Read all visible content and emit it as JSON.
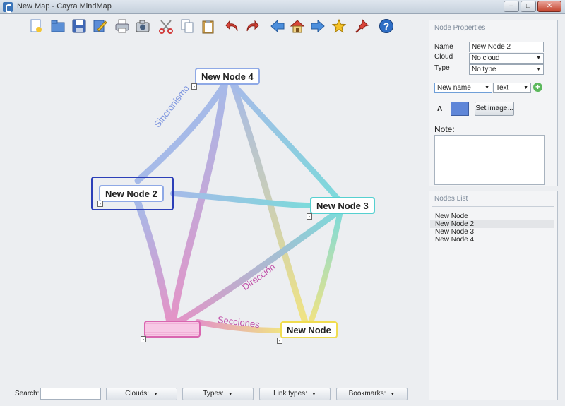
{
  "window": {
    "title": "New Map - Cayra MindMap",
    "min": "–",
    "max": "□",
    "close": "✕"
  },
  "toolbar": {
    "buttons": [
      {
        "name": "new-map-icon"
      },
      {
        "name": "open-icon"
      },
      {
        "name": "save-icon"
      },
      {
        "name": "edit-icon"
      },
      {
        "name": "print-icon"
      },
      {
        "name": "camera-icon"
      },
      {
        "name": "cut-icon"
      },
      {
        "name": "copy-icon"
      },
      {
        "name": "paste-icon"
      },
      {
        "name": "undo-icon"
      },
      {
        "name": "redo-icon"
      },
      {
        "name": "back-icon"
      },
      {
        "name": "home-icon"
      },
      {
        "name": "forward-icon"
      },
      {
        "name": "star-icon"
      },
      {
        "name": "pin-icon"
      },
      {
        "name": "help-icon"
      }
    ]
  },
  "map": {
    "nodes": {
      "node4": {
        "label": "New Node 4",
        "border": "#8fa9e6",
        "bg": "#ffffff"
      },
      "node2": {
        "label": "New Node 2",
        "border": "#8fa9e6",
        "bg": "#ffffff"
      },
      "node3": {
        "label": "New Node 3",
        "border": "#55d0d0",
        "bg": "#ffffff"
      },
      "node1": {
        "label": "New Node",
        "border": "#f0dc50",
        "bg": "#ffffff"
      },
      "root": {
        "label": "",
        "border": "#d966b0",
        "bg": "#f5c2e2"
      }
    },
    "collapse_symbol": "-",
    "link_labels": {
      "sincronismo": {
        "text": "Sincronismo",
        "color": "#7e96df"
      },
      "direccion": {
        "text": "Dirección",
        "color": "#c04da8"
      },
      "secciones": {
        "text": "Secciones",
        "color": "#c04da8"
      }
    }
  },
  "bottombar": {
    "search_label": "Search:",
    "search_value": "",
    "clouds": "Clouds:",
    "types": "Types:",
    "link_types": "Link types:",
    "bookmarks": "Bookmarks:"
  },
  "properties": {
    "title": "Node Properties",
    "name_label": "Name",
    "name_value": "New Node 2",
    "cloud_label": "Cloud",
    "cloud_value": "No cloud",
    "type_label": "Type",
    "type_value": "No type",
    "attr_name": "New name",
    "attr_type": "Text",
    "font_label": "A",
    "node_color": "#5f86d8",
    "set_image": "Set image...",
    "note_label": "Note:",
    "note_value": ""
  },
  "nodes_list": {
    "title": "Nodes List",
    "items": [
      "New Node",
      "New Node 2",
      "New Node 3",
      "New Node 4"
    ],
    "selected": "New Node 2"
  }
}
